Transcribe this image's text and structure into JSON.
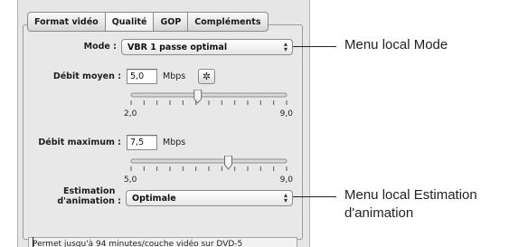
{
  "tabs": [
    "Format vidéo",
    "Qualité",
    "GOP",
    "Compléments"
  ],
  "mode": {
    "label": "Mode :",
    "value": "VBR 1 passe optimal"
  },
  "debit_moyen": {
    "label": "Débit moyen :",
    "value": "5,0",
    "unit": "Mbps",
    "slider_min": "2,0",
    "slider_max": "9,0",
    "slider_value": 5.0
  },
  "debit_maximum": {
    "label": "Débit maximum :",
    "value": "7,5",
    "unit": "Mbps",
    "slider_min": "5,0",
    "slider_max": "9,0",
    "slider_value": 7.5
  },
  "estimation": {
    "label_line1": "Estimation",
    "label_line2": "d'animation :",
    "value": "Optimale"
  },
  "status": "Permet jusqu'à 94 minutes/couche vidéo sur DVD-5",
  "callouts": {
    "mode": "Menu local Mode",
    "estimation_line1": "Menu local Estimation",
    "estimation_line2": "d'animation"
  },
  "icons": {
    "gear": "gear-icon",
    "popup_arrows": "up-down-arrows-icon"
  }
}
